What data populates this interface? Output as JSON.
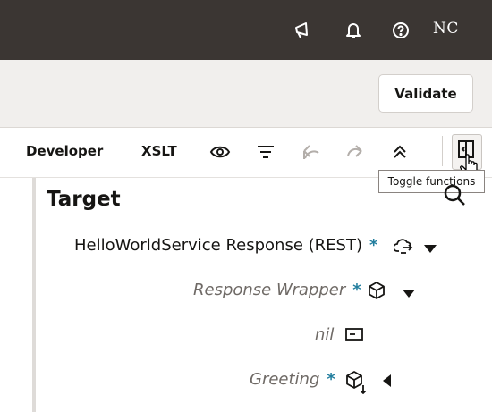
{
  "topbar": {
    "icons": [
      "megaphone-icon",
      "bell-icon",
      "help-icon"
    ],
    "user_initials": "NC"
  },
  "subbar": {
    "validate_label": "Validate"
  },
  "toolbar": {
    "developer_label": "Developer",
    "xslt_label": "XSLT",
    "icons": [
      "eye-icon",
      "filter-icon",
      "undo-icon",
      "redo-icon",
      "collapse-icon",
      "toggle-functions-icon"
    ],
    "tooltip": "Toggle functions"
  },
  "target": {
    "title": "Target",
    "nodes": [
      {
        "label": "HelloWorldService Response (REST)",
        "required": "*",
        "icon": "cloud-rest-icon",
        "expander": "caret-down-icon"
      },
      {
        "label": "Response Wrapper",
        "required": "*",
        "icon": "cube-icon",
        "expander": "caret-down-icon"
      },
      {
        "label": "nil",
        "required": "",
        "icon": "attribute-icon",
        "expander": ""
      },
      {
        "label": "Greeting",
        "required": "*",
        "icon": "cube-leaf-icon",
        "expander": "caret-left-icon"
      }
    ]
  },
  "colors": {
    "topbar": "#3b3633",
    "subbar": "#f1efed",
    "required_marker": "#227e9e"
  }
}
